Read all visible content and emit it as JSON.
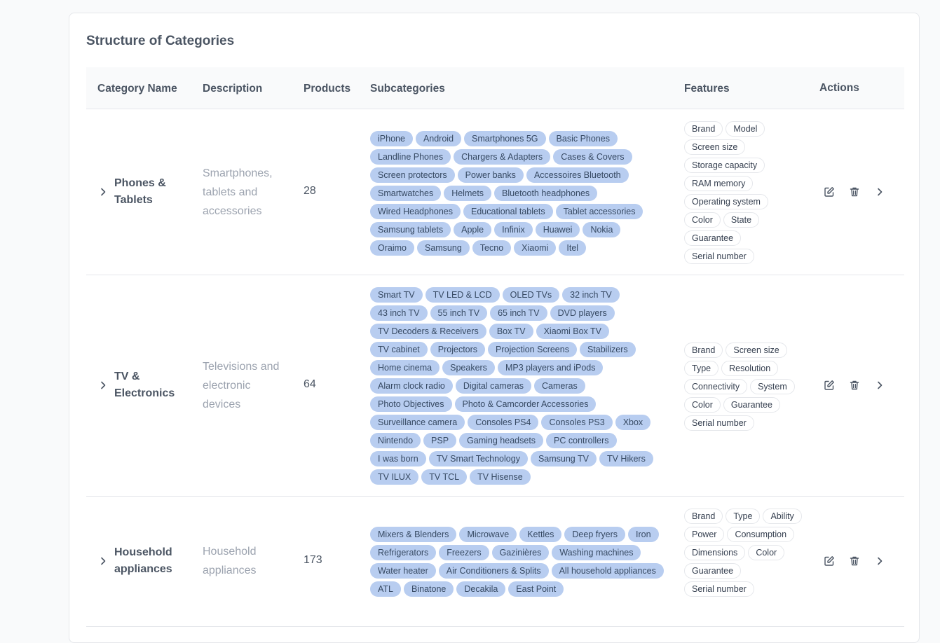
{
  "card": {
    "title": "Structure of Categories"
  },
  "table": {
    "headers": {
      "name": "Category Name",
      "description": "Description",
      "products": "Products",
      "subcategories": "Subcategories",
      "features": "Features",
      "actions": "Actions"
    },
    "rows": [
      {
        "name": "Phones & Tablets",
        "description": "Smartphones, tablets and accessories",
        "products": "28",
        "subcategories": [
          "iPhone",
          "Android",
          "Smartphones 5G",
          "Basic Phones",
          "Landline Phones",
          "Chargers & Adapters",
          "Cases & Covers",
          "Screen protectors",
          "Power banks",
          "Accessoires Bluetooth",
          "Smartwatches",
          "Helmets",
          "Bluetooth headphones",
          "Wired Headphones",
          "Educational tablets",
          "Tablet accessories",
          "Samsung tablets",
          "Apple",
          "Infinix",
          "Huawei",
          "Nokia",
          "Oraimo",
          "Samsung",
          "Tecno",
          "Xiaomi",
          "Itel"
        ],
        "features": [
          "Brand",
          "Model",
          "Screen size",
          "Storage capacity",
          "RAM memory",
          "Operating system",
          "Color",
          "State",
          "Guarantee",
          "Serial number"
        ]
      },
      {
        "name": "TV & Electronics",
        "description": "Televisions and electronic devices",
        "products": "64",
        "subcategories": [
          "Smart TV",
          "TV LED & LCD",
          "OLED TVs",
          "32 inch TV",
          "43 inch TV",
          "55 inch TV",
          "65 inch TV",
          "DVD players",
          "TV Decoders & Receivers",
          "Box TV",
          "Xiaomi Box TV",
          "TV cabinet",
          "Projectors",
          "Projection Screens",
          "Stabilizers",
          "Home cinema",
          "Speakers",
          "MP3 players and iPods",
          "Alarm clock radio",
          "Digital cameras",
          "Cameras",
          "Photo Objectives",
          "Photo & Camcorder Accessories",
          "Surveillance camera",
          "Consoles PS4",
          "Consoles PS3",
          "Xbox",
          "Nintendo",
          "PSP",
          "Gaming headsets",
          "PC controllers",
          "I was born",
          "TV Smart Technology",
          "Samsung TV",
          "TV Hikers",
          "TV ILUX",
          "TV TCL",
          "TV Hisense"
        ],
        "features": [
          "Brand",
          "Screen size",
          "Type",
          "Resolution",
          "Connectivity",
          "System",
          "Color",
          "Guarantee",
          "Serial number"
        ]
      },
      {
        "name": "Household appliances",
        "description": "Household appliances",
        "products": "173",
        "subcategories": [
          "Mixers & Blenders",
          "Microwave",
          "Kettles",
          "Deep fryers",
          "Iron",
          "Refrigerators",
          "Freezers",
          "Gazinières",
          "Washing machines",
          "Water heater",
          "Air Conditioners & Splits",
          "All household appliances",
          "ATL",
          "Binatone",
          "Decakila",
          "East Point"
        ],
        "features": [
          "Brand",
          "Type",
          "Ability",
          "Power",
          "Consumption",
          "Dimensions",
          "Color",
          "Guarantee",
          "Serial number"
        ]
      }
    ]
  },
  "icons": {
    "expand": "chevron-right-icon",
    "edit": "edit-icon",
    "delete": "trash-icon",
    "open": "chevron-right-icon"
  },
  "colors": {
    "chip_bg": "#b8cdf0",
    "chip_text": "#374a63",
    "border": "#e5e7eb",
    "header_bg": "#f9fafb"
  }
}
